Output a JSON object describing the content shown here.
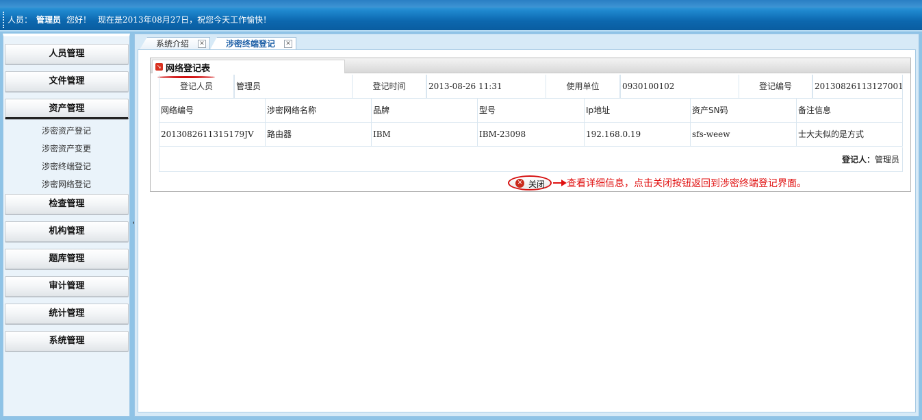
{
  "header": {
    "user_label": "人员：",
    "username": "管理员",
    "greeting": "您好！",
    "date_message": "现在是2013年08月27日，祝您今天工作愉快！"
  },
  "sidebar": {
    "menus": [
      {
        "label": "人员管理"
      },
      {
        "label": "文件管理"
      },
      {
        "label": "资产管理"
      },
      {
        "label": "检查管理"
      },
      {
        "label": "机构管理"
      },
      {
        "label": "题库管理"
      },
      {
        "label": "审计管理"
      },
      {
        "label": "统计管理"
      },
      {
        "label": "系统管理"
      }
    ],
    "submenu": [
      {
        "label": "涉密资产登记"
      },
      {
        "label": "涉密资产变更"
      },
      {
        "label": "涉密终端登记"
      },
      {
        "label": "涉密网络登记"
      }
    ],
    "collapse_icon": "«"
  },
  "tabs": [
    {
      "label": "系统介绍"
    },
    {
      "label": "涉密终端登记"
    }
  ],
  "panel": {
    "title": "网络登记表",
    "info_row": {
      "registrant_label": "登记人员",
      "registrant_value": "管理员",
      "time_label": "登记时间",
      "time_value": "2013-08-26 11:31",
      "unit_label": "使用单位",
      "unit_value": "0930100102",
      "number_label": "登记编号",
      "number_value": "20130826113127001"
    },
    "table": {
      "headers": [
        "网络编号",
        "涉密网络名称",
        "品牌",
        "型号",
        "Ip地址",
        "资产SN码",
        "备注信息"
      ],
      "row": [
        "2013082611315179JV",
        "路由器",
        "IBM",
        "IBM-23098",
        "192.168.0.19",
        "sfs-weew",
        "士大夫似的是方式"
      ]
    },
    "footer": {
      "registrant_label": "登记人：",
      "registrant_value": "管理员"
    },
    "close_button": "关闭",
    "annotation": "查看详细信息，点击关闭按钮返回到涉密终端登记界面。"
  },
  "colors": {
    "header_blue": "#0c67ae",
    "accent_red": "#e01010",
    "active_tab_text": "#1d5fa6"
  }
}
